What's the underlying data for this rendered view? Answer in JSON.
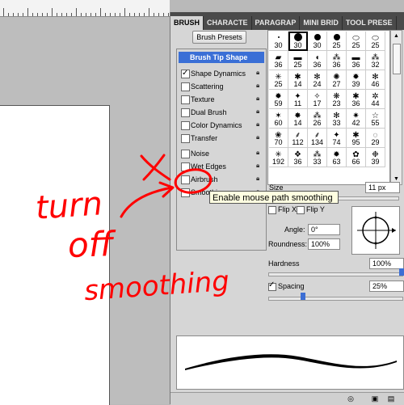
{
  "panel": {
    "tabs": [
      "BRUSH",
      "CHARACTE",
      "PARAGRAP",
      "MINI BRID",
      "TOOL PRESE"
    ],
    "brush_presets_button": "Brush Presets",
    "options": [
      {
        "label": "Brush Tip Shape",
        "header": true
      },
      {
        "label": "Shape Dynamics",
        "checked": true,
        "lock": true
      },
      {
        "label": "Scattering",
        "checked": false,
        "lock": true
      },
      {
        "label": "Texture",
        "checked": false,
        "lock": true
      },
      {
        "label": "Dual Brush",
        "checked": false,
        "lock": true
      },
      {
        "label": "Color Dynamics",
        "checked": false,
        "lock": true
      },
      {
        "label": "Transfer",
        "checked": false,
        "lock": true
      },
      {
        "label": "Noise",
        "checked": false,
        "lock": true
      },
      {
        "label": "Wet Edges",
        "checked": false,
        "lock": true
      },
      {
        "label": "Airbrush",
        "checked": false,
        "lock": true
      },
      {
        "label": "Smoothing",
        "checked": false,
        "lock": true
      }
    ],
    "brush_sizes": [
      "30",
      "30",
      "30",
      "25",
      "25",
      "25",
      "36",
      "25",
      "36",
      "36",
      "36",
      "32",
      "25",
      "14",
      "24",
      "27",
      "39",
      "46",
      "59",
      "11",
      "17",
      "23",
      "36",
      "44",
      "60",
      "14",
      "26",
      "33",
      "42",
      "55",
      "70",
      "112",
      "134",
      "74",
      "95",
      "29",
      "192",
      "36",
      "33",
      "63",
      "66",
      "39"
    ],
    "size_label": "Size",
    "size_value": "11 px",
    "flip_x": "Flip X",
    "flip_y": "Flip Y",
    "angle_label": "Angle:",
    "angle_value": "0°",
    "roundness_label": "Roundness:",
    "roundness_value": "100%",
    "hardness_label": "Hardness",
    "hardness_value": "100%",
    "hardness_fraction": 1.0,
    "spacing_label": "Spacing",
    "spacing_checked": true,
    "spacing_value": "25%",
    "spacing_fraction": 0.25
  },
  "tooltip": "Enable mouse path smoothing",
  "annotation": {
    "line1": "turn",
    "line2": "off",
    "line3": "smoothing",
    "color": "#ff0000"
  }
}
